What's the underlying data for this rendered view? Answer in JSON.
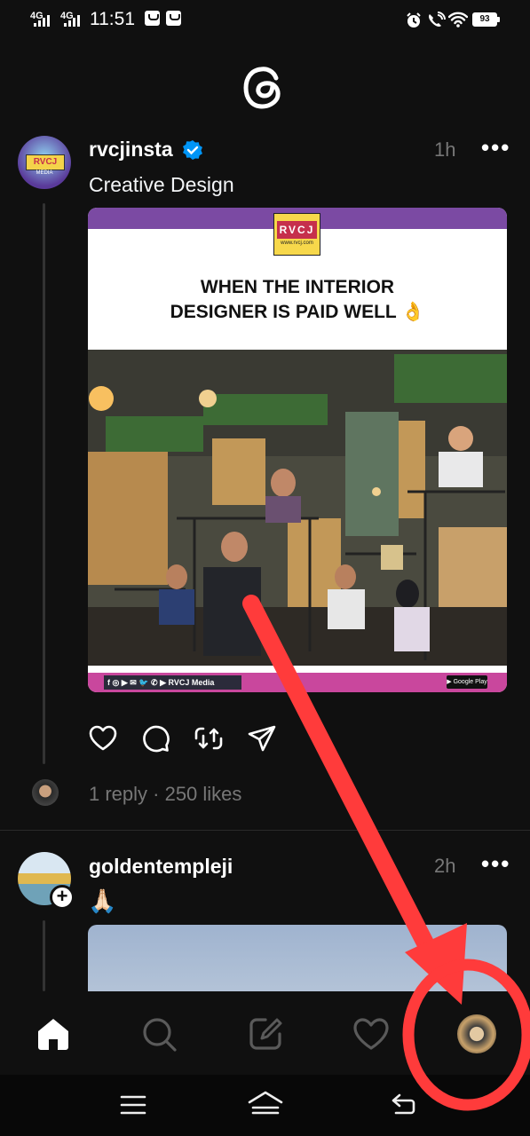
{
  "status_bar": {
    "network_1": "4G",
    "network_2": "4G",
    "time": "11:51",
    "battery": "93"
  },
  "app": {
    "logo_icon": "threads-logo-icon"
  },
  "post1": {
    "username": "rvcjinsta",
    "verified": true,
    "time": "1h",
    "more": "•••",
    "caption": "Creative Design",
    "card": {
      "brand": "RVCJ",
      "brand_sub": "www.rvcj.com",
      "avatar_brand": "RVCJ",
      "avatar_sub": "MEDIA",
      "headline_line1": "WHEN THE INTERIOR",
      "headline_line2": "DESIGNER IS PAID WELL",
      "headline_emoji": "👌",
      "footer_socials": "f ◎ ▶ ✉ 🐦 ✆ ▶ RVCJ Media",
      "footer_store": "▶ Google Play"
    },
    "reply_summary": "1 reply · 250 likes",
    "actions": [
      "like-icon",
      "comment-icon",
      "repost-icon",
      "share-icon"
    ]
  },
  "post2": {
    "username": "goldentempleji",
    "time": "2h",
    "more": "•••",
    "caption_emoji": "🙏🏻",
    "follow_badge": "+"
  },
  "bottom_nav": [
    "home-icon",
    "search-icon",
    "compose-icon",
    "activity-heart-icon",
    "profile-avatar-icon"
  ],
  "system_nav": [
    "menu-icon",
    "home-icon",
    "back-icon"
  ],
  "colors": {
    "background": "#101010",
    "muted_text": "#777777",
    "verified_blue": "#0095f6",
    "annotation_red": "#ff3b3b"
  }
}
